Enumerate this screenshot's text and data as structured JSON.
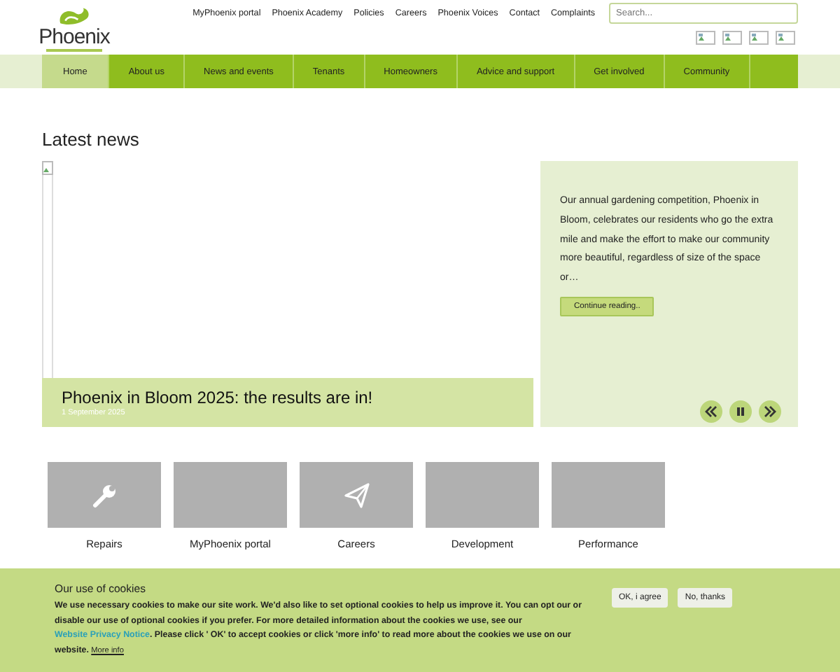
{
  "logo": {
    "name": "Phoenix"
  },
  "top_links": [
    "MyPhoenix portal",
    "Phoenix Academy",
    "Policies",
    "Careers",
    "Phoenix Voices",
    "Contact",
    "Complaints"
  ],
  "search": {
    "placeholder": "Search..."
  },
  "nav": [
    {
      "label": "Home",
      "selected": true
    },
    {
      "label": "About us",
      "selected": false
    },
    {
      "label": "News and events",
      "selected": false
    },
    {
      "label": "Tenants",
      "selected": false
    },
    {
      "label": "Homeowners",
      "selected": false
    },
    {
      "label": "Advice and support",
      "selected": false
    },
    {
      "label": "Get involved",
      "selected": false
    },
    {
      "label": "Community",
      "selected": false
    }
  ],
  "section_title": "Latest news",
  "slide": {
    "title": "Phoenix in Bloom 2025: the results are in!",
    "date": "1 September 2025",
    "summary": "Our annual gardening competition, Phoenix in Bloom, celebrates our residents who go the extra mile and make the effort to make our community more beautiful, regardless of size of the space or…",
    "button": "Continue reading.."
  },
  "tiles": [
    {
      "label": "Repairs",
      "kind": "wrench"
    },
    {
      "label": "MyPhoenix portal",
      "kind": "blank"
    },
    {
      "label": "Careers",
      "kind": "plane"
    },
    {
      "label": "Development",
      "kind": "blank"
    },
    {
      "label": "Performance",
      "kind": "blank"
    }
  ],
  "cookies": {
    "title": "Our use of cookies",
    "text_before": "We use necessary cookies to make our site work. We'd also like to set optional cookies to help us improve it. You can opt our or disable our use of optional cookies if you prefer. For more detailed information about the cookies we use, see our",
    "link": "Website Privacy Notice",
    "text_after": ". Please click ' OK' to accept cookies or click 'more info' to read more about the cookies we use on our website.",
    "more": "More info",
    "buttons": [
      "OK, i agree",
      "No, thanks"
    ]
  }
}
